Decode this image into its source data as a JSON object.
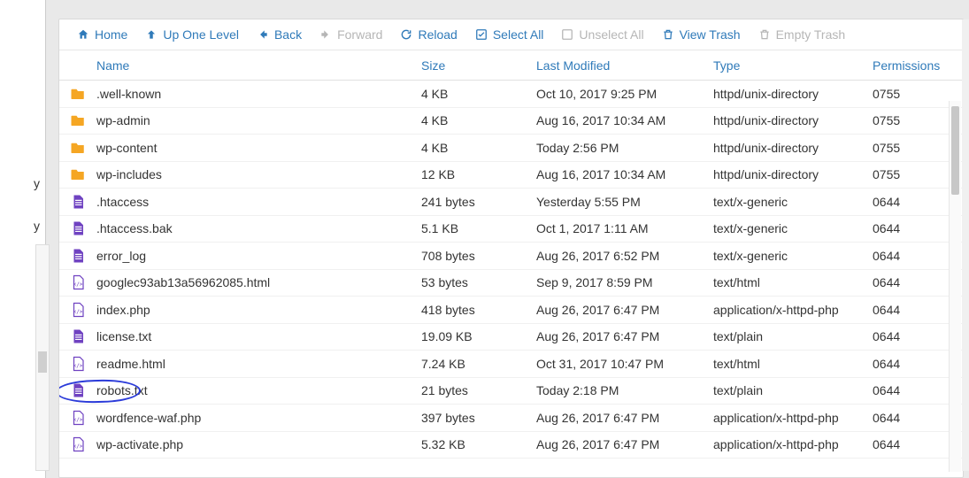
{
  "toolbar": {
    "home": "Home",
    "up": "Up One Level",
    "back": "Back",
    "forward": "Forward",
    "reload": "Reload",
    "selectAll": "Select All",
    "unselectAll": "Unselect All",
    "viewTrash": "View Trash",
    "emptyTrash": "Empty Trash"
  },
  "columns": {
    "name": "Name",
    "size": "Size",
    "modified": "Last Modified",
    "type": "Type",
    "permissions": "Permissions"
  },
  "leftFragments": {
    "f1": "y",
    "f2": "y"
  },
  "files": [
    {
      "icon": "folder",
      "name": ".well-known",
      "size": "4 KB",
      "modified": "Oct 10, 2017 9:25 PM",
      "type": "httpd/unix-directory",
      "perm": "0755"
    },
    {
      "icon": "folder",
      "name": "wp-admin",
      "size": "4 KB",
      "modified": "Aug 16, 2017 10:34 AM",
      "type": "httpd/unix-directory",
      "perm": "0755"
    },
    {
      "icon": "folder",
      "name": "wp-content",
      "size": "4 KB",
      "modified": "Today 2:56 PM",
      "type": "httpd/unix-directory",
      "perm": "0755"
    },
    {
      "icon": "folder",
      "name": "wp-includes",
      "size": "12 KB",
      "modified": "Aug 16, 2017 10:34 AM",
      "type": "httpd/unix-directory",
      "perm": "0755"
    },
    {
      "icon": "doc",
      "name": ".htaccess",
      "size": "241 bytes",
      "modified": "Yesterday 5:55 PM",
      "type": "text/x-generic",
      "perm": "0644"
    },
    {
      "icon": "doc",
      "name": ".htaccess.bak",
      "size": "5.1 KB",
      "modified": "Oct 1, 2017 1:11 AM",
      "type": "text/x-generic",
      "perm": "0644"
    },
    {
      "icon": "doc",
      "name": "error_log",
      "size": "708 bytes",
      "modified": "Aug 26, 2017 6:52 PM",
      "type": "text/x-generic",
      "perm": "0644"
    },
    {
      "icon": "code",
      "name": "googlec93ab13a56962085.html",
      "size": "53 bytes",
      "modified": "Sep 9, 2017 8:59 PM",
      "type": "text/html",
      "perm": "0644"
    },
    {
      "icon": "code",
      "name": "index.php",
      "size": "418 bytes",
      "modified": "Aug 26, 2017 6:47 PM",
      "type": "application/x-httpd-php",
      "perm": "0644"
    },
    {
      "icon": "doc",
      "name": "license.txt",
      "size": "19.09 KB",
      "modified": "Aug 26, 2017 6:47 PM",
      "type": "text/plain",
      "perm": "0644"
    },
    {
      "icon": "code",
      "name": "readme.html",
      "size": "7.24 KB",
      "modified": "Oct 31, 2017 10:47 PM",
      "type": "text/html",
      "perm": "0644"
    },
    {
      "icon": "doc",
      "name": "robots.txt",
      "size": "21 bytes",
      "modified": "Today 2:18 PM",
      "type": "text/plain",
      "perm": "0644",
      "circled": true
    },
    {
      "icon": "code",
      "name": "wordfence-waf.php",
      "size": "397 bytes",
      "modified": "Aug 26, 2017 6:47 PM",
      "type": "application/x-httpd-php",
      "perm": "0644"
    },
    {
      "icon": "code",
      "name": "wp-activate.php",
      "size": "5.32 KB",
      "modified": "Aug 26, 2017 6:47 PM",
      "type": "application/x-httpd-php",
      "perm": "0644"
    }
  ]
}
